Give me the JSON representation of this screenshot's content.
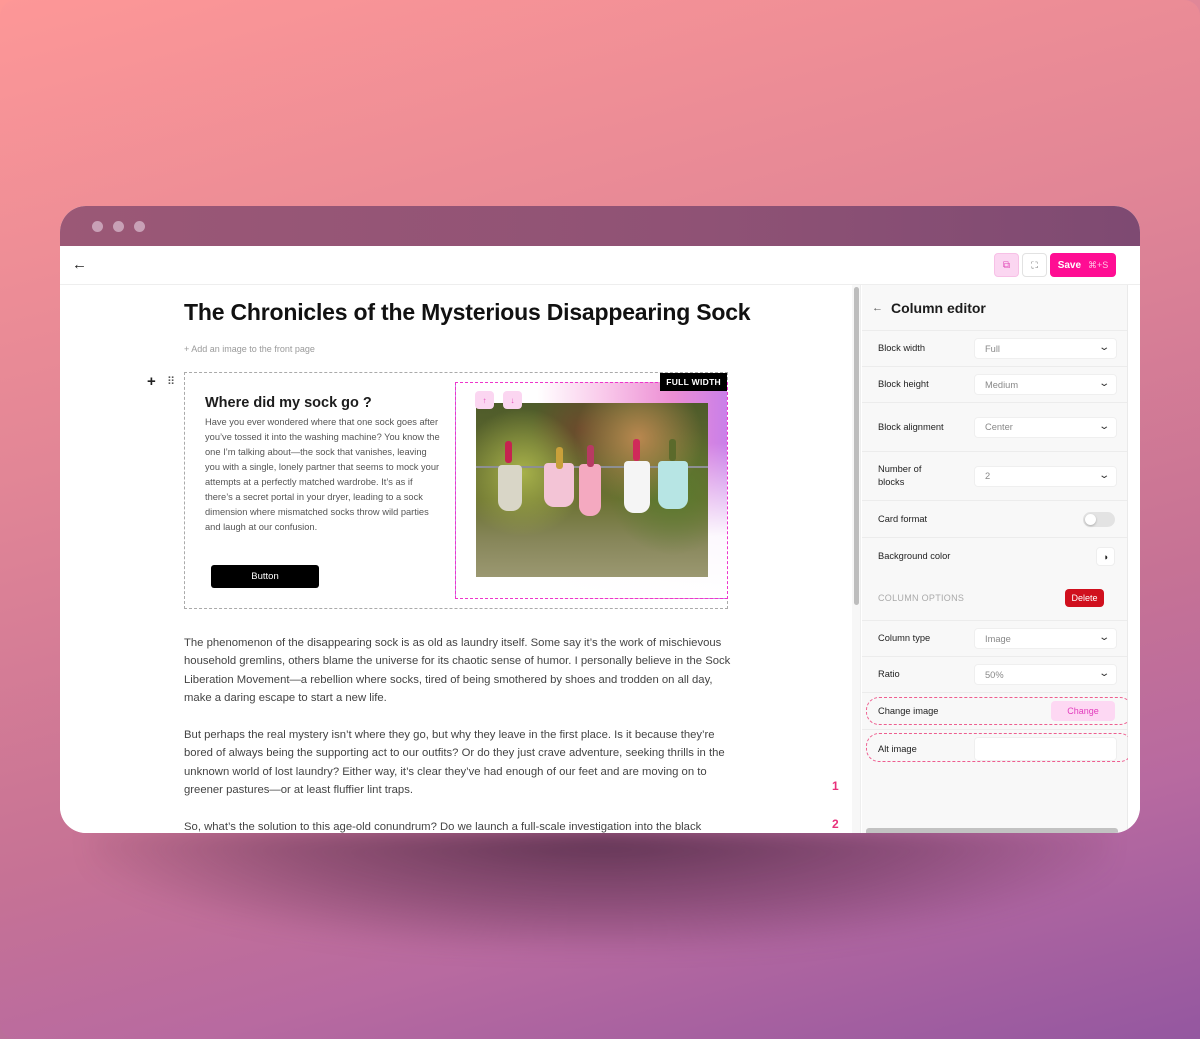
{
  "window": {
    "traffic_lights": [
      "close",
      "minimize",
      "maximize"
    ]
  },
  "toolbar": {
    "back_icon": "←",
    "open_icon": "⧉",
    "expand_icon": "⛶",
    "save_label": "Save",
    "save_shortcut": "⌘+S"
  },
  "document": {
    "title": "The Chronicles of the Mysterious Disappearing Sock",
    "add_image_link": "+ Add an image to the front page",
    "block_add_icon": "+",
    "block_drag_icon": "⠿",
    "column_block": {
      "heading": "Where did my sock go ?",
      "body": "Have you ever wondered where that one sock goes after you’ve tossed it into the washing machine? You know the one I’m talking about—the sock that vanishes, leaving you with a single, lonely partner that seems to mock your attempts at a perfectly matched wardrobe. It’s as if there’s a secret portal in your dryer, leading to a sock dimension where mismatched socks throw wild parties and laugh at our confusion.",
      "button_label": "Button",
      "full_width_tag": "FULL WIDTH",
      "move_up_icon": "↑",
      "move_down_icon": "↓",
      "image_description": "socks hanging on a clothesline"
    },
    "paragraphs": [
      "The phenomenon of the disappearing sock is as old as laundry itself. Some say it’s the work of mischievous household gremlins, others blame the universe for its chaotic sense of humor. I personally believe in the Sock Liberation Movement—a rebellion where socks, tired of being smothered by shoes and trodden on all day, make a daring escape to start a new life.",
      "But perhaps the real mystery isn’t where they go, but why they leave in the first place. Is it because they’re bored of always being the supporting act to our outfits? Or do they just crave adventure, seeking thrills in the unknown world of lost laundry? Either way, it’s clear they’ve had enough of our feet and are moving on to greener pastures—or at least fluffier lint traps.",
      "So, what’s the solution to this age-old conundrum? Do we launch a full-scale investigation into the black"
    ]
  },
  "annotations": [
    "1",
    "2"
  ],
  "panel": {
    "title": "Column editor",
    "back_icon": "←",
    "fields": {
      "block_width": {
        "label": "Block width",
        "value": "Full"
      },
      "block_height": {
        "label": "Block height",
        "value": "Medium"
      },
      "block_alignment": {
        "label": "Block alignment",
        "value": "Center"
      },
      "number_of_blocks": {
        "label": "Number of blocks",
        "value": "2"
      },
      "card_format": {
        "label": "Card format",
        "enabled": false
      },
      "background_color": {
        "label": "Background color",
        "icon": "◑"
      }
    },
    "column_options": {
      "section_title": "COLUMN OPTIONS",
      "delete_label": "Delete",
      "column_type": {
        "label": "Column type",
        "value": "Image"
      },
      "ratio": {
        "label": "Ratio",
        "value": "50%"
      },
      "change_image": {
        "label": "Change image",
        "button_label": "Change"
      },
      "alt_image": {
        "label": "Alt image",
        "value": "",
        "placeholder": ""
      }
    },
    "chevron_icon": "⌄"
  },
  "colors": {
    "accent": "#ff0d93",
    "accent_soft": "#fbd6f1",
    "danger": "#d0101e",
    "highlight_dashed": "#ee5d8f",
    "selection_dashed": "#ee35cc"
  }
}
